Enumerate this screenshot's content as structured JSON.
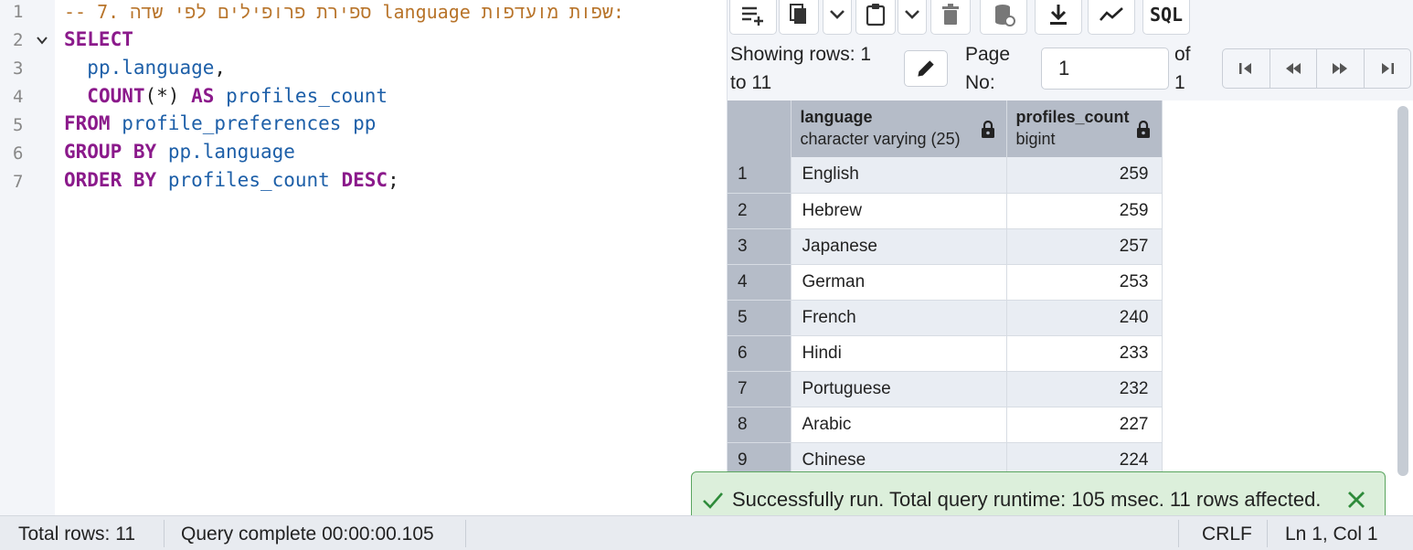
{
  "editor": {
    "line_numbers": [
      "1",
      "2",
      "3",
      "4",
      "5",
      "6",
      "7"
    ],
    "comment_line": "-- 7. ספירת פרופילים לפי שדה language שפות מועדפות:",
    "line2": {
      "kw": "SELECT"
    },
    "line3": {
      "id": "pp.language",
      "op": ","
    },
    "line4": {
      "kw1": "COUNT",
      "op": "(*)",
      "kw2": "AS",
      "id": "profiles_count"
    },
    "line5": {
      "kw": "FROM",
      "id": "profile_preferences pp"
    },
    "line6": {
      "kw": "GROUP BY",
      "id": "pp.language"
    },
    "line7": {
      "kw1": "ORDER BY",
      "id": "profiles_count",
      "kw2": "DESC",
      "op": ";"
    }
  },
  "toolbar": {
    "icons": [
      "add-row-icon",
      "copy-icon",
      "chevron-down-icon",
      "paste-icon",
      "chevron-down-icon",
      "delete-icon",
      "save-data-icon",
      "download-icon",
      "graph-icon"
    ],
    "sql_label": "SQL"
  },
  "pager": {
    "showing_line1": "Showing rows: 1",
    "showing_line2": "to 11",
    "page_line1": "Page",
    "page_line2": "No:",
    "page_value": "1",
    "of_line1": "of",
    "of_line2": "1"
  },
  "grid": {
    "columns": [
      {
        "name": "language",
        "type": "character varying (25)"
      },
      {
        "name": "profiles_count",
        "type": "bigint"
      }
    ],
    "rows": [
      {
        "n": "1",
        "language": "English",
        "count": "259"
      },
      {
        "n": "2",
        "language": "Hebrew",
        "count": "259"
      },
      {
        "n": "3",
        "language": "Japanese",
        "count": "257"
      },
      {
        "n": "4",
        "language": "German",
        "count": "253"
      },
      {
        "n": "5",
        "language": "French",
        "count": "240"
      },
      {
        "n": "6",
        "language": "Hindi",
        "count": "233"
      },
      {
        "n": "7",
        "language": "Portuguese",
        "count": "232"
      },
      {
        "n": "8",
        "language": "Arabic",
        "count": "227"
      },
      {
        "n": "9",
        "language": "Chinese",
        "count": "224"
      }
    ]
  },
  "toast": {
    "message": "Successfully run. Total query runtime: 105 msec. 11 rows affected."
  },
  "status": {
    "total_rows": "Total rows: 11",
    "query_complete": "Query complete 00:00:00.105",
    "line_ending": "CRLF",
    "cursor": "Ln 1, Col 1"
  },
  "colors": {
    "keyword": "#8b1a8b",
    "identifier": "#1d5fa8",
    "comment": "#b8742a",
    "success_bg": "#dcefdb",
    "success_border": "#5aa55f"
  }
}
